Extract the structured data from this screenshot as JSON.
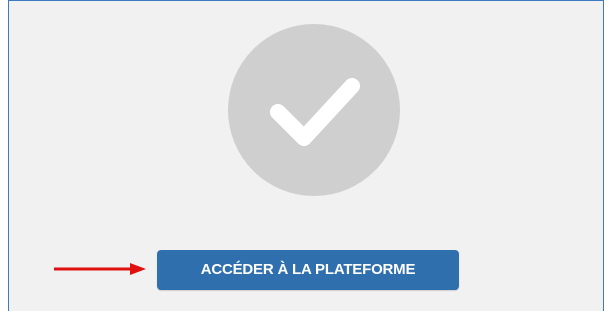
{
  "button": {
    "label": "ACCÉDER À LA PLATEFORME"
  },
  "icons": {
    "status": "check-circle-icon",
    "pointer": "red-arrow-icon"
  },
  "colors": {
    "panel_background": "#f1f1f1",
    "panel_border": "#3b7bbf",
    "circle": "#cfcfcf",
    "checkmark": "#ffffff",
    "button_background": "#2f6fae",
    "button_text": "#ffffff",
    "arrow": "#e01010"
  }
}
